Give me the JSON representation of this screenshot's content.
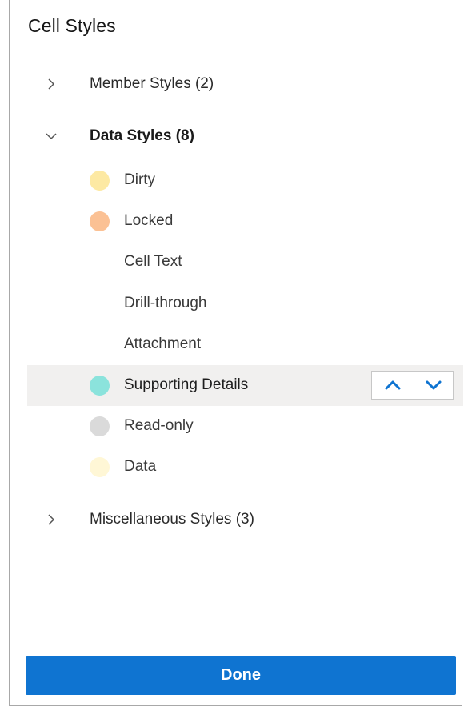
{
  "panel": {
    "title": "Cell Styles"
  },
  "groups": {
    "member": {
      "label": "Member Styles (2)",
      "expanded": false
    },
    "data": {
      "label": "Data Styles (8)",
      "expanded": true
    },
    "misc": {
      "label": "Miscellaneous Styles (3)",
      "expanded": false
    }
  },
  "data_styles": [
    {
      "label": "Dirty",
      "color": "#fde9a3"
    },
    {
      "label": "Locked",
      "color": "#fbc194"
    },
    {
      "label": "Cell Text",
      "color": ""
    },
    {
      "label": "Drill-through",
      "color": ""
    },
    {
      "label": "Attachment",
      "color": ""
    },
    {
      "label": "Supporting Details",
      "color": "#8be3dc",
      "selected": true
    },
    {
      "label": "Read-only",
      "color": "#dadada"
    },
    {
      "label": "Data",
      "color": "#fff7d6"
    }
  ],
  "icons": {
    "collapsed": "chevron-right-icon",
    "expanded": "chevron-down-icon",
    "move_up": "chevron-up-icon",
    "move_down": "chevron-down-icon"
  },
  "colors": {
    "accent": "#0f74d1",
    "selected_row": "#f1f0ef"
  },
  "footer": {
    "done_label": "Done"
  }
}
